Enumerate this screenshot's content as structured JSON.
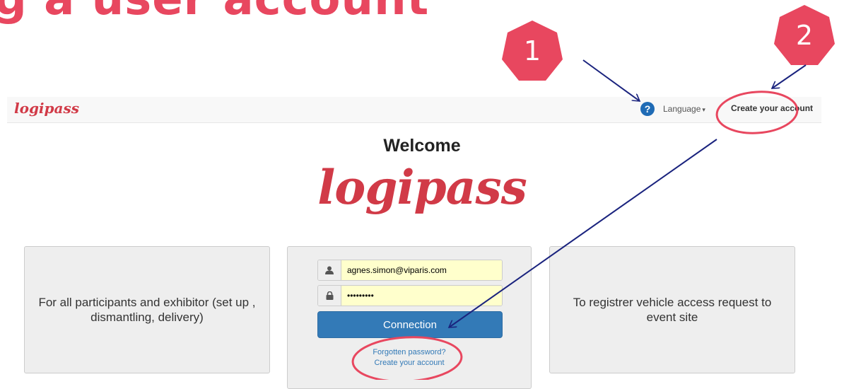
{
  "slide": {
    "title": "g a user account",
    "badges": [
      "1",
      "2"
    ],
    "colors": {
      "accent": "#e8475f",
      "arrow": "#1a237e"
    }
  },
  "navbar": {
    "brand": "logipass",
    "language_label": "Language",
    "create_account": "Create your account"
  },
  "main": {
    "welcome": "Welcome",
    "logo_text": "logipass",
    "left_panel": "For all participants and exhibitor (set up , dismantling, delivery)",
    "right_panel": "To registrer vehicle access request to event site",
    "login": {
      "email_value": "agnes.simon@viparis.com",
      "password_value": "password1",
      "connect_label": "Connection",
      "forgot_link": "Forgotten password?",
      "create_link": "Create your account"
    }
  },
  "colors": {
    "brand_red": "#d13a47",
    "primary_blue": "#337ab7",
    "help_blue": "#1f6bb5",
    "link_blue": "#337ab7"
  }
}
